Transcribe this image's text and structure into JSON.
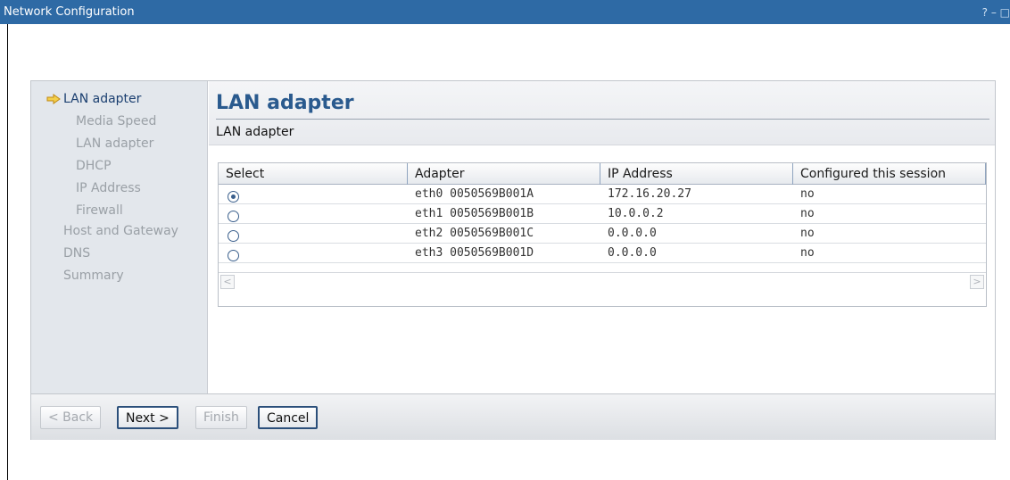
{
  "window": {
    "title": "Network Configuration",
    "controls": "? – □"
  },
  "nav": {
    "items": [
      {
        "label": "LAN adapter",
        "level": 0,
        "state": "active"
      },
      {
        "label": "Media Speed",
        "level": 1,
        "state": "disabled"
      },
      {
        "label": "LAN adapter",
        "level": 1,
        "state": "disabled"
      },
      {
        "label": "DHCP",
        "level": 1,
        "state": "disabled"
      },
      {
        "label": "IP Address",
        "level": 1,
        "state": "disabled"
      },
      {
        "label": "Firewall",
        "level": 1,
        "state": "disabled"
      },
      {
        "label": "Host and Gateway",
        "level": 0,
        "state": "disabled"
      },
      {
        "label": "DNS",
        "level": 0,
        "state": "disabled"
      },
      {
        "label": "Summary",
        "level": 0,
        "state": "disabled"
      }
    ]
  },
  "page": {
    "title": "LAN adapter",
    "subtitle": "LAN adapter"
  },
  "table": {
    "columns": [
      "Select",
      "Adapter",
      "IP Address",
      "Configured this session"
    ],
    "rows": [
      {
        "selected": true,
        "adapter": "eth0 0050569B001A",
        "ip": "172.16.20.27",
        "configured": "no"
      },
      {
        "selected": false,
        "adapter": "eth1 0050569B001B",
        "ip": "10.0.0.2",
        "configured": "no"
      },
      {
        "selected": false,
        "adapter": "eth2 0050569B001C",
        "ip": "0.0.0.0",
        "configured": "no"
      },
      {
        "selected": false,
        "adapter": "eth3 0050569B001D",
        "ip": "0.0.0.0",
        "configured": "no"
      }
    ],
    "scroll_left": "<",
    "scroll_right": ">"
  },
  "footer": {
    "back": "< Back",
    "next": "Next >",
    "finish": "Finish",
    "cancel": "Cancel"
  },
  "colors": {
    "titlebar": "#2e6aa5",
    "heading": "#2a5a8e",
    "nav_bg": "#e3e7ec",
    "nav_active": "#1b3f70",
    "arrow": "#e6b62a"
  }
}
